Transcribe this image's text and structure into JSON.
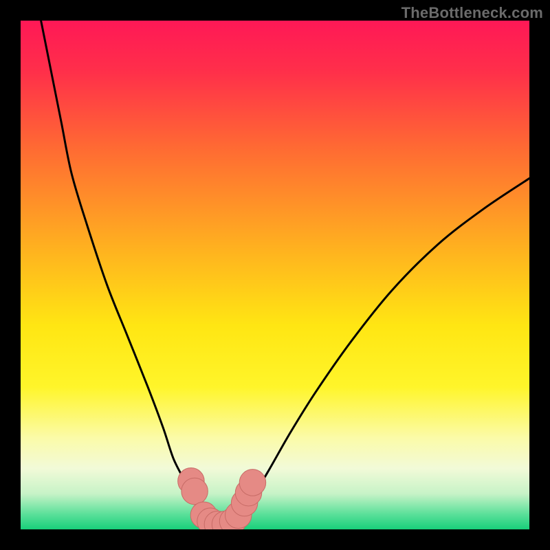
{
  "watermark": "TheBottleneck.com",
  "colors": {
    "background": "#000000",
    "gradient_stops": [
      {
        "offset": 0.0,
        "color": "#ff1856"
      },
      {
        "offset": 0.1,
        "color": "#ff2f4a"
      },
      {
        "offset": 0.25,
        "color": "#ff6a33"
      },
      {
        "offset": 0.45,
        "color": "#ffb21f"
      },
      {
        "offset": 0.6,
        "color": "#ffe613"
      },
      {
        "offset": 0.72,
        "color": "#fff52a"
      },
      {
        "offset": 0.82,
        "color": "#fbfba8"
      },
      {
        "offset": 0.88,
        "color": "#f2fad8"
      },
      {
        "offset": 0.93,
        "color": "#c7f3c7"
      },
      {
        "offset": 0.97,
        "color": "#5be09a"
      },
      {
        "offset": 1.0,
        "color": "#18cf7a"
      }
    ],
    "curve": "#000000",
    "marker_fill": "#e58a85",
    "marker_stroke": "#c76b66"
  },
  "chart_data": {
    "type": "line",
    "title": "",
    "xlabel": "",
    "ylabel": "",
    "xlim": [
      0,
      100
    ],
    "ylim": [
      0,
      100
    ],
    "series": [
      {
        "name": "left-curve",
        "x": [
          4,
          6,
          8,
          10,
          13,
          17,
          21,
          25,
          28,
          30,
          32,
          33.5,
          35,
          36.5,
          38
        ],
        "y": [
          100,
          90,
          80,
          70,
          60,
          48,
          38,
          28,
          20,
          14,
          10,
          7,
          4.5,
          2.5,
          1
        ]
      },
      {
        "name": "right-curve",
        "x": [
          41,
          42.5,
          44,
          46,
          49,
          53,
          58,
          65,
          73,
          82,
          91,
          100
        ],
        "y": [
          1,
          2.5,
          4.5,
          7,
          12,
          19,
          27,
          37,
          47,
          56,
          63,
          69
        ]
      },
      {
        "name": "valley-floor",
        "x": [
          35,
          36,
          37,
          38,
          39,
          40,
          41,
          42,
          43,
          44
        ],
        "y": [
          4,
          2.5,
          1.6,
          1.1,
          0.9,
          0.9,
          1.1,
          1.6,
          2.5,
          4
        ]
      }
    ],
    "markers": {
      "name": "highlighted-points",
      "points": [
        {
          "x": 33.5,
          "y": 9.5
        },
        {
          "x": 34.2,
          "y": 7.5
        },
        {
          "x": 36.0,
          "y": 2.8
        },
        {
          "x": 37.3,
          "y": 1.6
        },
        {
          "x": 38.7,
          "y": 1.0
        },
        {
          "x": 40.2,
          "y": 1.0
        },
        {
          "x": 41.7,
          "y": 1.6
        },
        {
          "x": 42.8,
          "y": 2.8
        },
        {
          "x": 44.0,
          "y": 5.2
        },
        {
          "x": 44.8,
          "y": 7.2
        },
        {
          "x": 45.6,
          "y": 9.2
        }
      ],
      "radius": 2.6
    }
  }
}
